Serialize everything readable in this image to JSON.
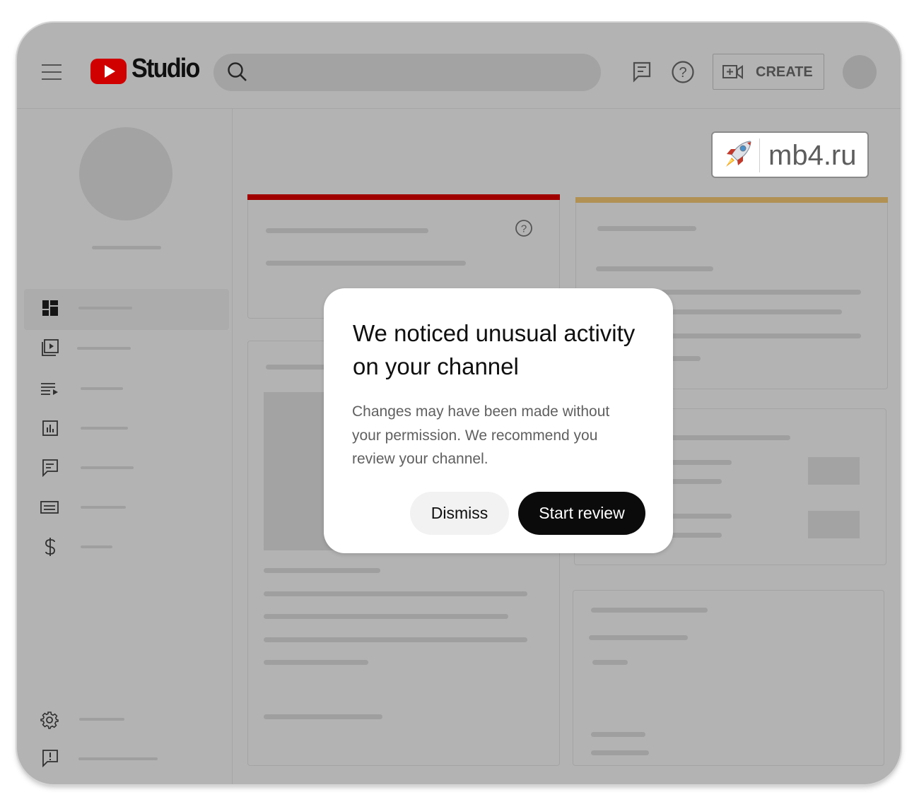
{
  "app": {
    "logo_text": "Studio",
    "create_label": "CREATE",
    "brand_color": "#ff0000"
  },
  "icons": {
    "menu": "hamburger-menu-icon",
    "search": "search-icon",
    "feedback": "message-lines-icon",
    "help": "question-circle-icon",
    "create": "video-plus-icon",
    "sidebar": [
      "dashboard-icon",
      "content-icon",
      "playlists-icon",
      "analytics-icon",
      "comments-icon",
      "subtitles-icon",
      "earn-icon",
      "settings-icon",
      "send-feedback-icon"
    ]
  },
  "cards": {
    "accent_left": "#a10000",
    "accent_right": "#b29155"
  },
  "dialog": {
    "title": "We noticed unusual activity on your channel",
    "body": "Changes may have been made without your permission. We recommend you review your channel.",
    "dismiss_label": "Dismiss",
    "review_label": "Start review"
  },
  "watermark": {
    "text": "mb4.ru"
  }
}
